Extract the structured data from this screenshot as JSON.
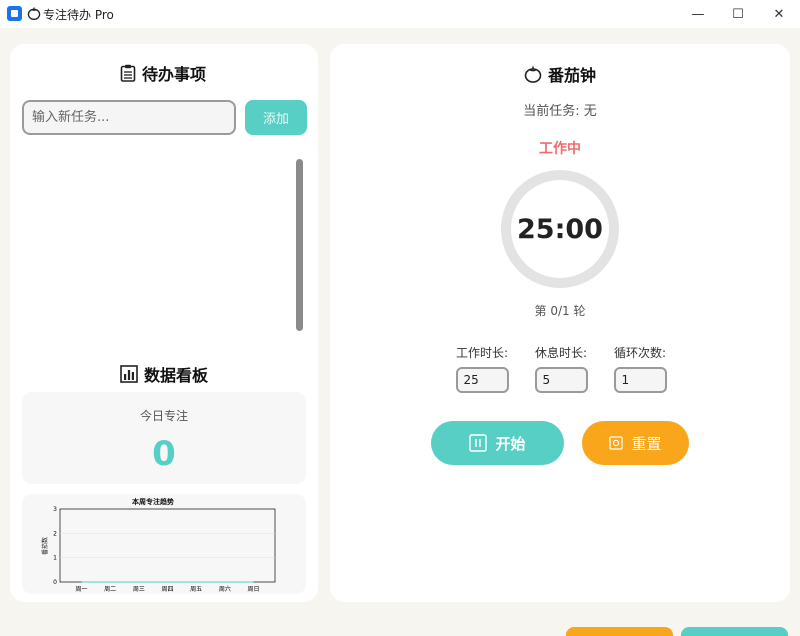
{
  "window": {
    "title": "专注待办 Pro",
    "controls": {
      "minimize": "—",
      "maximize": "☐",
      "close": "✕"
    }
  },
  "todo": {
    "title": "待办事项",
    "input_placeholder": "输入新任务...",
    "add_label": "添加",
    "items": []
  },
  "dashboard": {
    "title": "数据看板",
    "today_label": "今日专注",
    "today_value": "0"
  },
  "chart_data": {
    "type": "line",
    "title": "本周专注趋势",
    "ylabel": "番茄数",
    "categories": [
      "周一",
      "周二",
      "周三",
      "周四",
      "周五",
      "周六",
      "周日"
    ],
    "series": [
      {
        "values": [
          0,
          0,
          0,
          0,
          0,
          0,
          0
        ]
      }
    ],
    "ylim": [
      0,
      3
    ],
    "yticks": [
      "0",
      "1",
      "2",
      "3"
    ],
    "grid": true
  },
  "pomodoro": {
    "title": "番茄钟",
    "current_task": "当前任务: 无",
    "status": "工作中",
    "timer": "25:00",
    "rounds": "第 0/1 轮",
    "work_label": "工作时长:",
    "work_value": "25",
    "rest_label": "休息时长:",
    "rest_value": "5",
    "cycle_label": "循环次数:",
    "cycle_value": "1",
    "start_label": "开始",
    "reset_label": "重置"
  },
  "colors": {
    "accent": "#57cfc4",
    "warning": "#f9a61a",
    "status": "#f26b6b"
  }
}
